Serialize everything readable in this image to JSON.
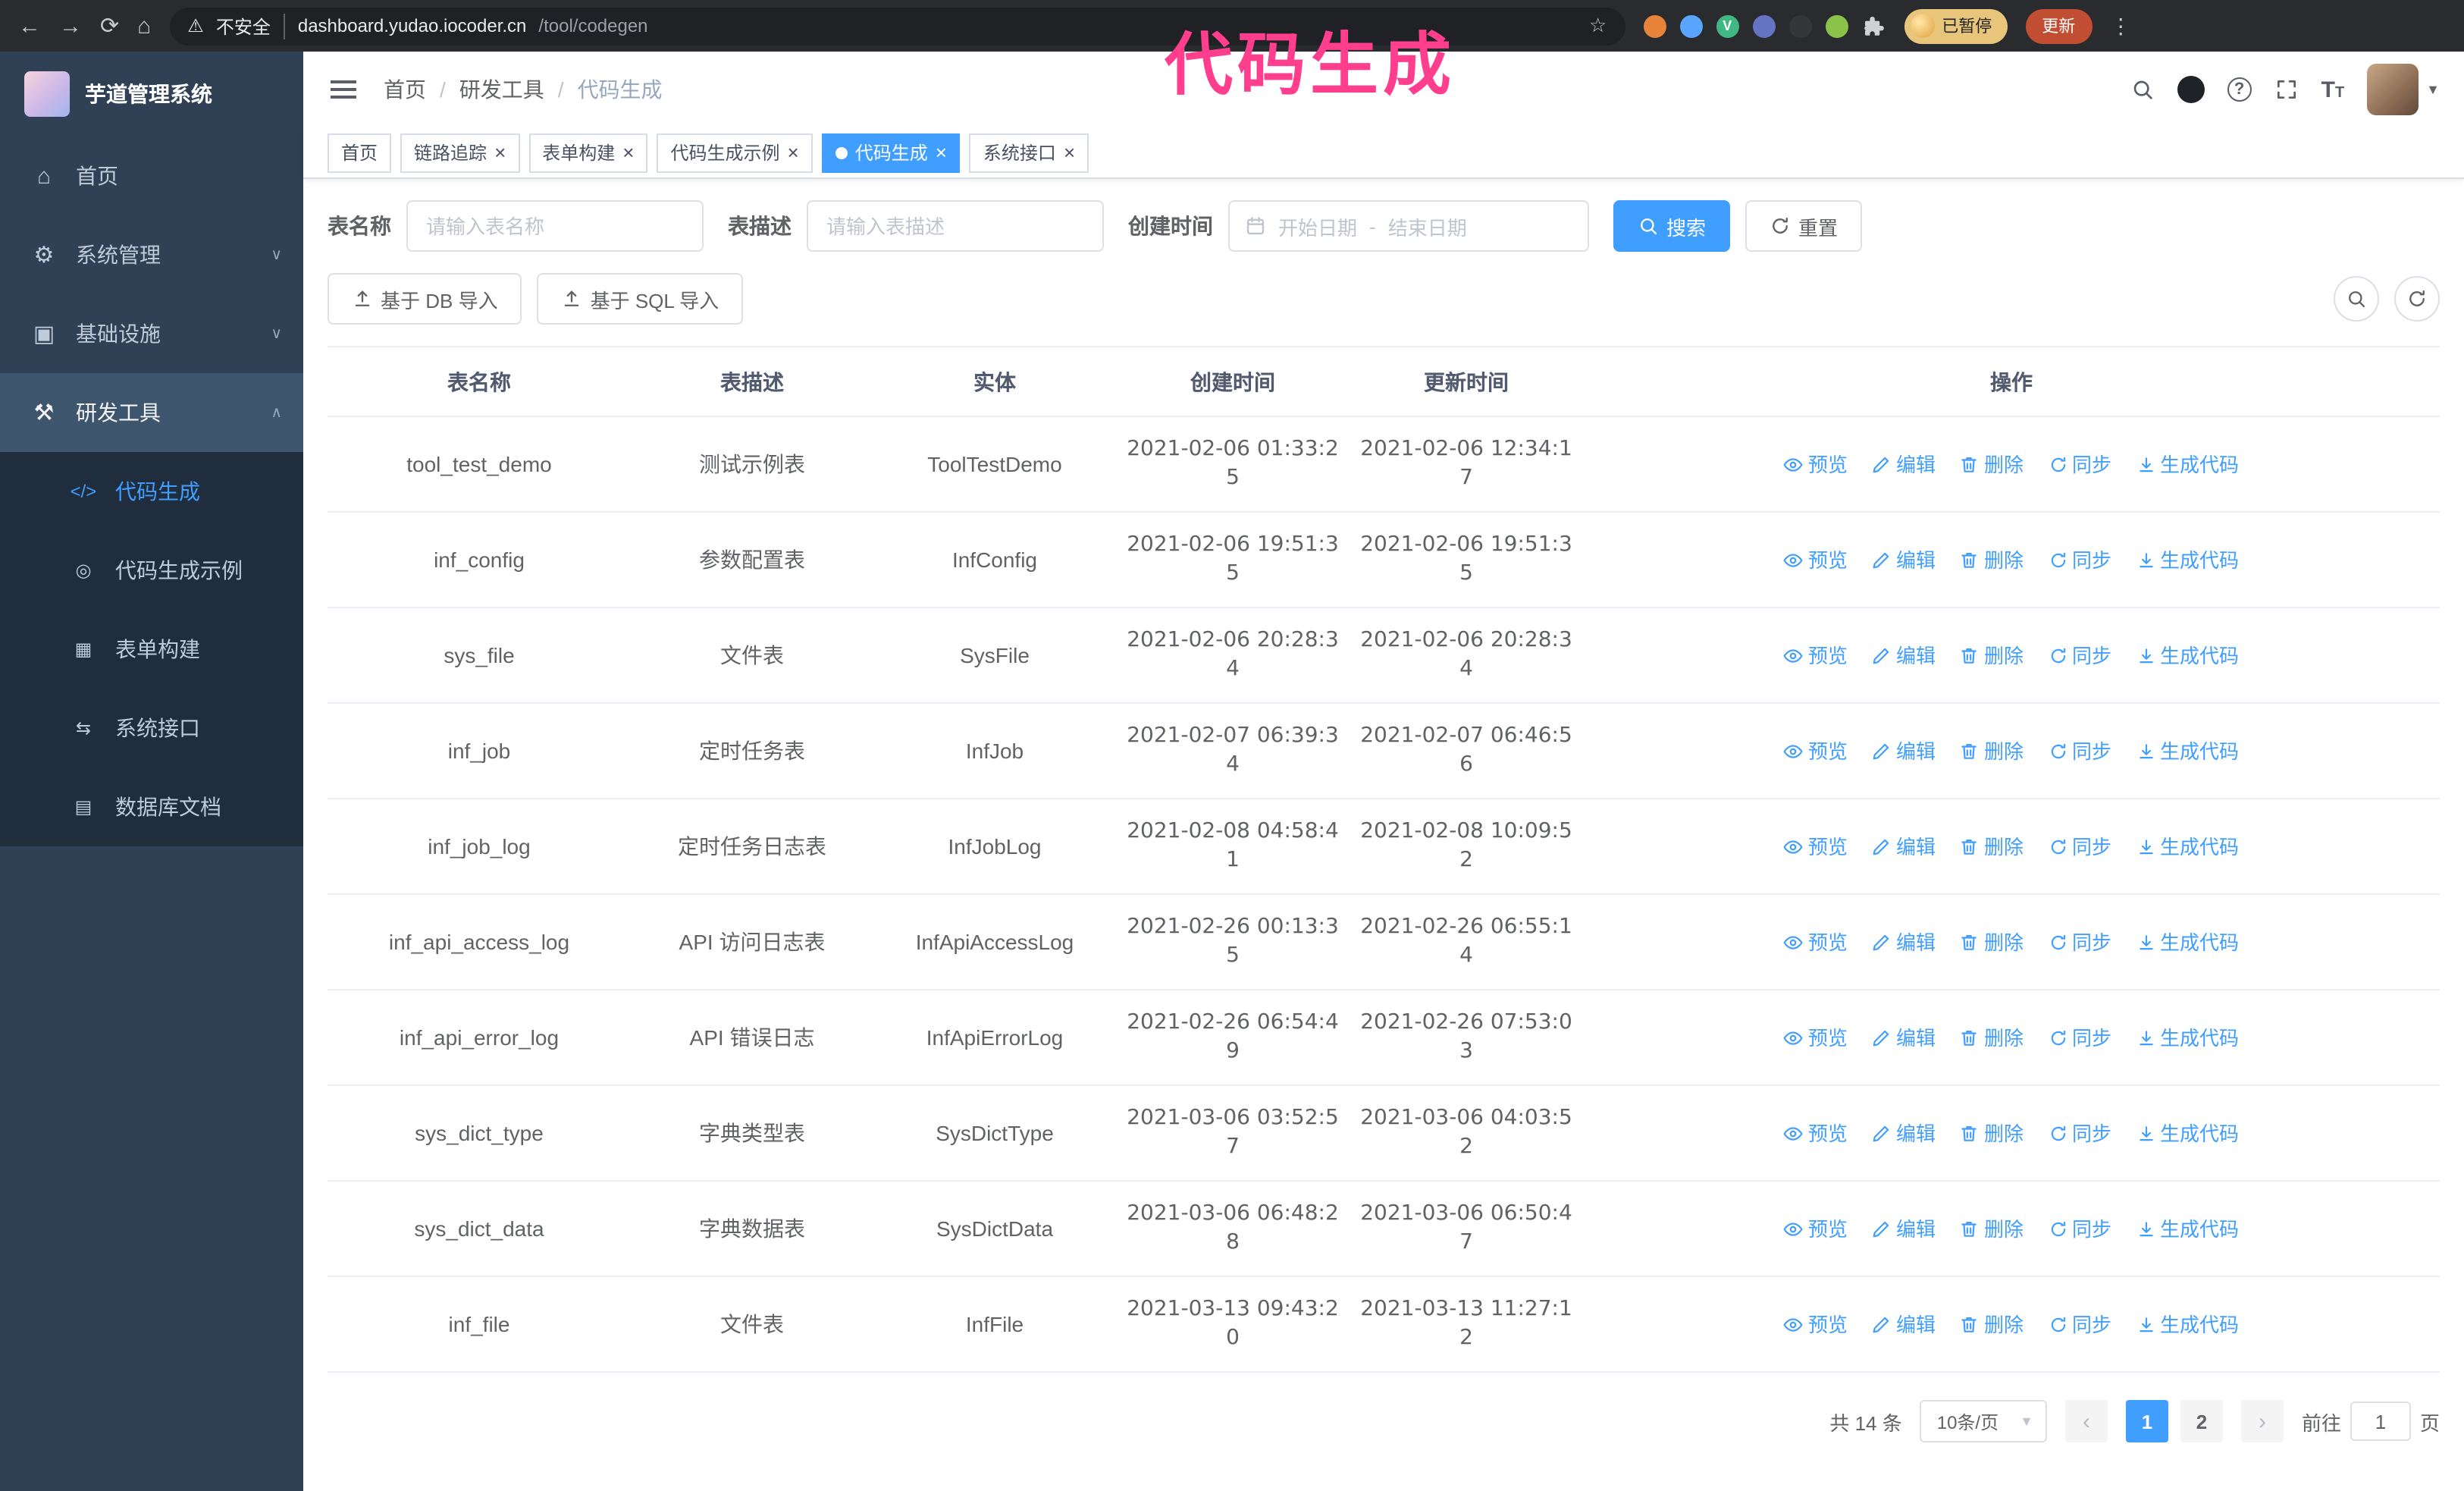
{
  "colors": {
    "accent": "#409eff",
    "annotation": "#ff3e8e",
    "sidebar_bg": "#304156",
    "submenu_bg": "#1f2d3d"
  },
  "annotation": {
    "text": "代码生成"
  },
  "browser": {
    "security_warning": "不安全",
    "url_domain": "dashboard.yudao.iocoder.cn",
    "url_path": "/tool/codegen",
    "profile_badge": "已暂停",
    "update_button": "更新"
  },
  "sidebar": {
    "logo_title": "芋道管理系统",
    "items": [
      {
        "id": "home",
        "label": "首页",
        "icon": "home-icon"
      },
      {
        "id": "system-management",
        "label": "系统管理",
        "icon": "gear-icon",
        "expand": "down"
      },
      {
        "id": "infrastructure",
        "label": "基础设施",
        "icon": "infrastructure-icon",
        "expand": "down"
      },
      {
        "id": "dev-tools",
        "label": "研发工具",
        "icon": "tools-icon",
        "expand": "up",
        "active": true,
        "submenu": [
          {
            "id": "codegen",
            "label": "代码生成",
            "icon": "code-icon",
            "active": true
          },
          {
            "id": "codegen-example",
            "label": "代码生成示例",
            "icon": "example-icon"
          },
          {
            "id": "form-builder",
            "label": "表单构建",
            "icon": "form-icon"
          },
          {
            "id": "system-api",
            "label": "系统接口",
            "icon": "api-icon"
          },
          {
            "id": "db-doc",
            "label": "数据库文档",
            "icon": "dbdoc-icon"
          }
        ]
      }
    ]
  },
  "header": {
    "breadcrumb": [
      "首页",
      "研发工具",
      "代码生成"
    ]
  },
  "tabs": [
    {
      "label": "首页",
      "closable": false,
      "active": false
    },
    {
      "label": "链路追踪",
      "closable": true,
      "active": false
    },
    {
      "label": "表单构建",
      "closable": true,
      "active": false
    },
    {
      "label": "代码生成示例",
      "closable": true,
      "active": false
    },
    {
      "label": "代码生成",
      "closable": true,
      "active": true
    },
    {
      "label": "系统接口",
      "closable": true,
      "active": false
    }
  ],
  "filters": {
    "table_name_label": "表名称",
    "table_name_placeholder": "请输入表名称",
    "table_desc_label": "表描述",
    "table_desc_placeholder": "请输入表描述",
    "create_time_label": "创建时间",
    "date_start_placeholder": "开始日期",
    "date_separator": "-",
    "date_end_placeholder": "结束日期",
    "search_button": "搜索",
    "reset_button": "重置"
  },
  "toolbar": {
    "import_db": "基于 DB 导入",
    "import_sql": "基于 SQL 导入"
  },
  "table": {
    "columns": [
      "表名称",
      "表描述",
      "实体",
      "创建时间",
      "更新时间",
      "操作"
    ],
    "actions": [
      "预览",
      "编辑",
      "删除",
      "同步",
      "生成代码"
    ],
    "rows": [
      [
        "tool_test_demo",
        "测试示例表",
        "ToolTestDemo",
        "2021-02-06 01:33:25",
        "2021-02-06 12:34:17"
      ],
      [
        "inf_config",
        "参数配置表",
        "InfConfig",
        "2021-02-06 19:51:35",
        "2021-02-06 19:51:35"
      ],
      [
        "sys_file",
        "文件表",
        "SysFile",
        "2021-02-06 20:28:34",
        "2021-02-06 20:28:34"
      ],
      [
        "inf_job",
        "定时任务表",
        "InfJob",
        "2021-02-07 06:39:34",
        "2021-02-07 06:46:56"
      ],
      [
        "inf_job_log",
        "定时任务日志表",
        "InfJobLog",
        "2021-02-08 04:58:41",
        "2021-02-08 10:09:52"
      ],
      [
        "inf_api_access_log",
        "API 访问日志表",
        "InfApiAccessLog",
        "2021-02-26 00:13:35",
        "2021-02-26 06:55:14"
      ],
      [
        "inf_api_error_log",
        "API 错误日志",
        "InfApiErrorLog",
        "2021-02-26 06:54:49",
        "2021-02-26 07:53:03"
      ],
      [
        "sys_dict_type",
        "字典类型表",
        "SysDictType",
        "2021-03-06 03:52:57",
        "2021-03-06 04:03:52"
      ],
      [
        "sys_dict_data",
        "字典数据表",
        "SysDictData",
        "2021-03-06 06:48:28",
        "2021-03-06 06:50:47"
      ],
      [
        "inf_file",
        "文件表",
        "InfFile",
        "2021-03-13 09:43:20",
        "2021-03-13 11:27:12"
      ]
    ]
  },
  "pagination": {
    "total_label": "共 14 条",
    "page_size": "10条/页",
    "pages": [
      "1",
      "2"
    ],
    "active_page": "1",
    "goto_label": "前往",
    "goto_value": "1",
    "goto_suffix": "页"
  }
}
